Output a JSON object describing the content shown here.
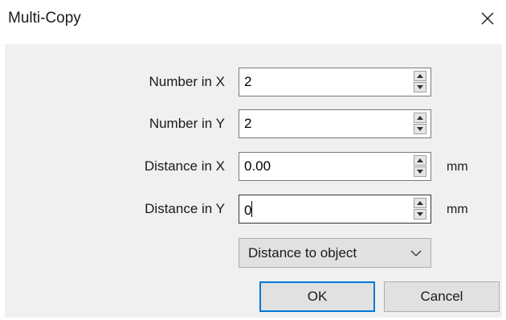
{
  "dialog": {
    "title": "Multi-Copy"
  },
  "fields": [
    {
      "label": "Number in X",
      "value": "2",
      "unit": ""
    },
    {
      "label": "Number in Y",
      "value": "2",
      "unit": ""
    },
    {
      "label": "Distance in X",
      "value": "0.00",
      "unit": "mm"
    },
    {
      "label": "Distance in Y",
      "value": "0",
      "unit": "mm"
    }
  ],
  "distance_mode": {
    "selected": "Distance to object"
  },
  "buttons": {
    "ok": "OK",
    "cancel": "Cancel"
  },
  "icons": {
    "close": "close-icon",
    "spin": "spin-arrows-icon",
    "dropdown": "chevron-down-icon"
  },
  "colors": {
    "accent": "#0078d7"
  }
}
